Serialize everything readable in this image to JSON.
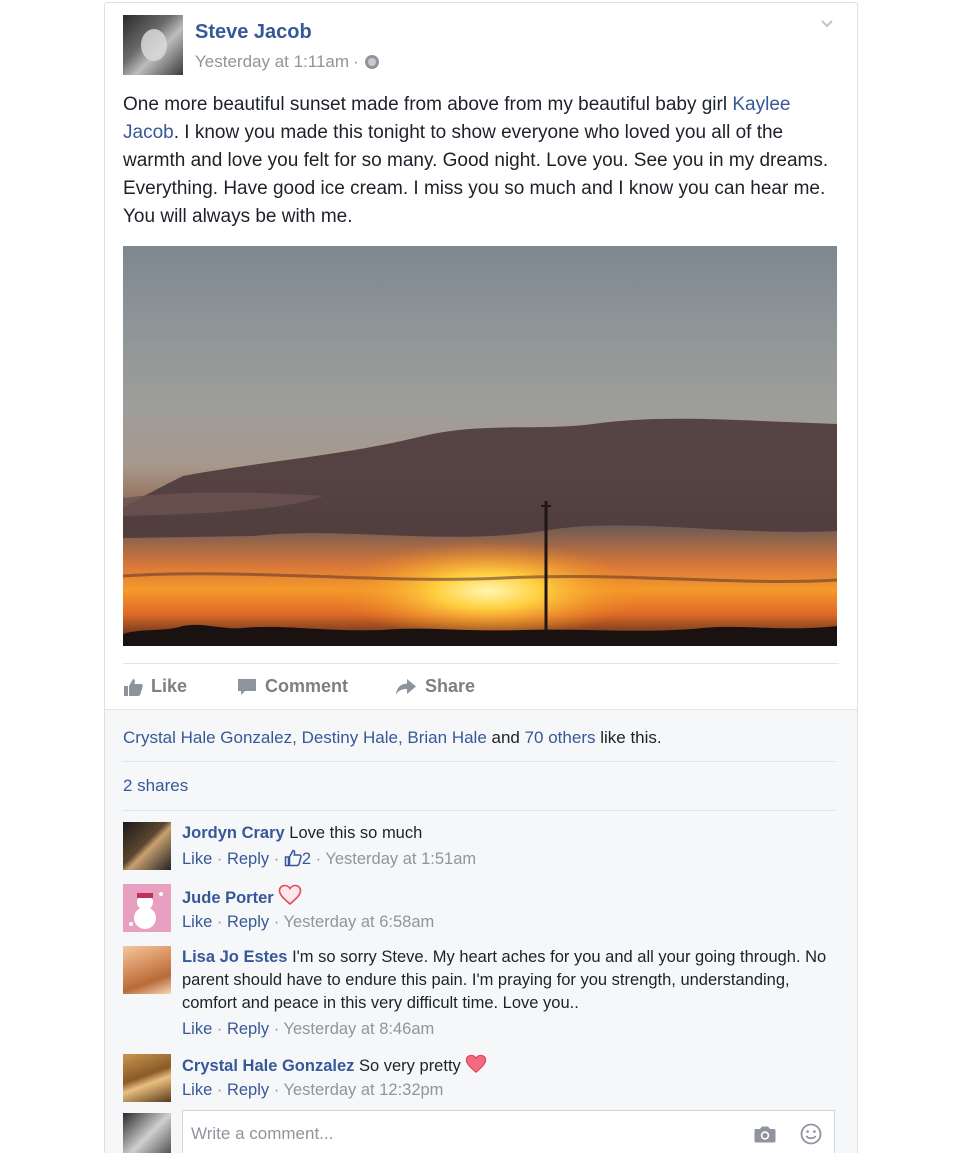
{
  "post": {
    "author": "Steve Jacob",
    "timestamp": "Yesterday at 1:11am",
    "meta_separator": "·",
    "text_before": "One more beautiful sunset made from above from my beautiful baby girl ",
    "mention": "Kaylee Jacob",
    "text_after": ". I know you made this tonight to show everyone who loved you all of the warmth and love you felt for so many. Good night. Love you. See you in my dreams. Everything. Have good ice cream. I miss you so much and I know you can hear me. You will always be with me."
  },
  "actions": {
    "like": "Like",
    "comment": "Comment",
    "share": "Share"
  },
  "likes": {
    "name1": "Crystal Hale Gonzalez",
    "comma1": ", ",
    "name2": "Destiny Hale",
    "comma2": ", ",
    "name3": "Brian Hale",
    "and": " and ",
    "others": "70 others",
    "suffix": " like this."
  },
  "shares": "2 shares",
  "comments": [
    {
      "name": "Jordyn Crary",
      "text": " Love this so much",
      "like": "Like",
      "reply": "Reply",
      "reactions": "2",
      "time": "Yesterday at 1:51am"
    },
    {
      "name": "Jude Porter",
      "text": "",
      "like": "Like",
      "reply": "Reply",
      "time": "Yesterday at 6:58am"
    },
    {
      "name": "Lisa Jo Estes",
      "text": " I'm so sorry Steve. My heart aches for you and all your going through. No parent should have to endure this pain. I'm praying for you strength, understanding, comfort and peace in this very difficult time. Love you..",
      "like": "Like",
      "reply": "Reply",
      "time": "Yesterday at 8:46am"
    },
    {
      "name": "Crystal Hale Gonzalez",
      "text": " So very pretty",
      "like": "Like",
      "reply": "Reply",
      "time": "Yesterday at 12:32pm"
    }
  ],
  "dot": " · ",
  "write_comment": {
    "placeholder": "Write a comment..."
  },
  "colors": {
    "link": "#365899",
    "muted": "#90949c",
    "heart": "#e0475e",
    "footer_bg": "#f6f7f9"
  },
  "icons": [
    "chevron-down-icon",
    "globe-icon",
    "like-icon",
    "comment-icon",
    "share-icon",
    "thumbs-up-icon",
    "heart-icon",
    "camera-icon",
    "smiley-icon"
  ]
}
